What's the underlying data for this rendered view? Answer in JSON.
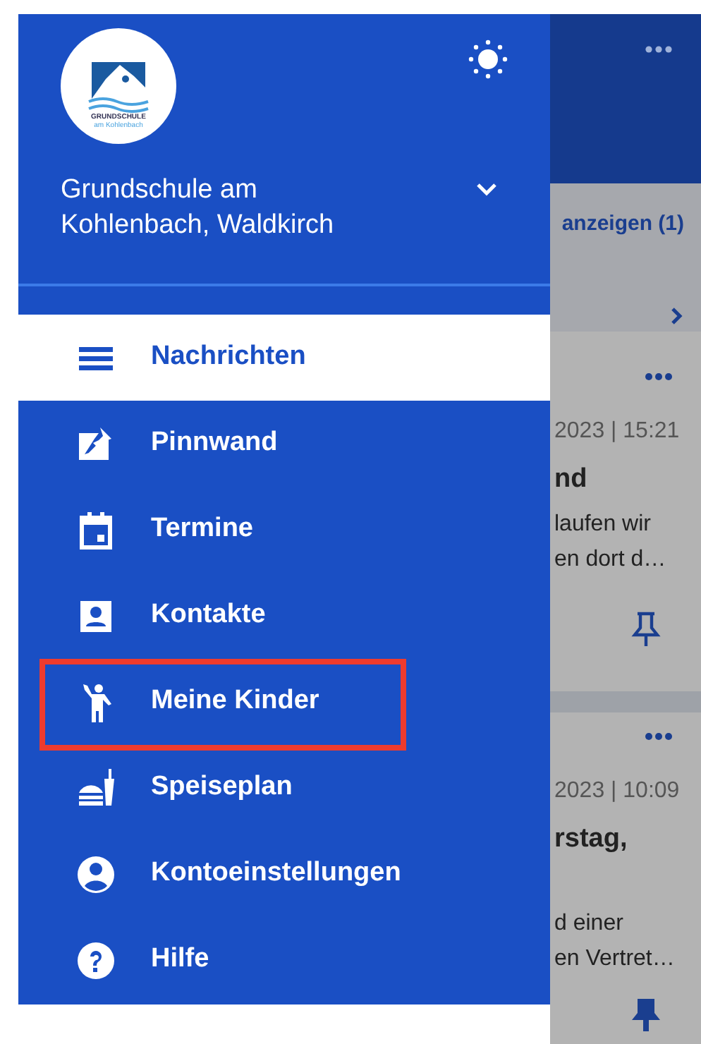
{
  "drawer": {
    "school": {
      "logo_lines": [
        "GRUNDSCHULE",
        "am Kohlenbach"
      ],
      "name": "Grundschule am Kohlenbach, Waldkirch",
      "expanded": false
    },
    "items": [
      {
        "kind": "messages",
        "label": "Nachrichten",
        "selected": true,
        "highlighted": false
      },
      {
        "kind": "pinboard",
        "label": "Pinnwand",
        "selected": false,
        "highlighted": false
      },
      {
        "kind": "calendar",
        "label": "Termine",
        "selected": false,
        "highlighted": false
      },
      {
        "kind": "contacts",
        "label": "Kontakte",
        "selected": false,
        "highlighted": false
      },
      {
        "kind": "children",
        "label": "Meine Kinder",
        "selected": false,
        "highlighted": true
      },
      {
        "kind": "menu",
        "label": "Speiseplan",
        "selected": false,
        "highlighted": false
      },
      {
        "kind": "account",
        "label": "Kontoeinstellungen",
        "selected": false,
        "highlighted": false
      },
      {
        "kind": "help",
        "label": "Hilfe",
        "selected": false,
        "highlighted": false
      }
    ]
  },
  "background": {
    "banner": "anzeigen (1)",
    "posts": [
      {
        "time": "2023 | 15:21",
        "title": "nd",
        "lines": [
          "laufen wir",
          "en dort d…"
        ],
        "pinned": false
      },
      {
        "time": "2023 | 10:09",
        "title": "rstag,",
        "lines": [
          "d einer",
          "en Vertret…"
        ],
        "pinned": true
      }
    ]
  }
}
